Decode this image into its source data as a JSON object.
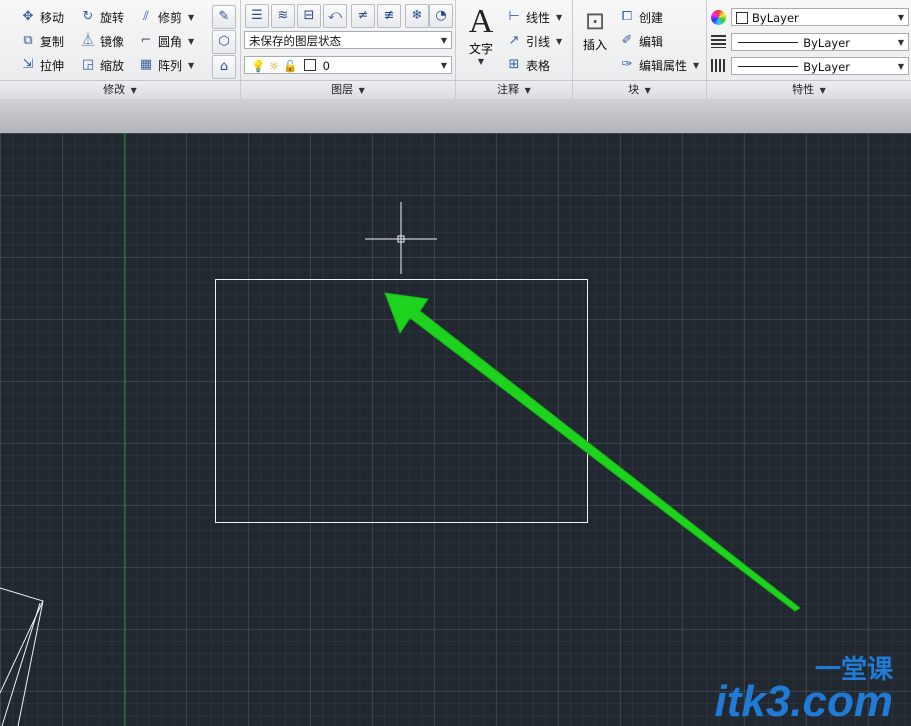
{
  "ribbon": {
    "modify": {
      "title": "修改",
      "move": "移动",
      "rotate": "旋转",
      "trim": "修剪",
      "copy": "复制",
      "mirror": "镜像",
      "fillet": "圆角",
      "stretch": "拉伸",
      "scale": "缩放",
      "array": "阵列"
    },
    "layers": {
      "title": "图层",
      "layer_state": "未保存的图层状态",
      "current_layer": "0"
    },
    "annotation": {
      "title": "注释",
      "text": "文字",
      "linear": "线性",
      "leader": "引线",
      "table": "表格"
    },
    "block": {
      "title": "块",
      "insert": "插入",
      "create": "创建",
      "edit": "编辑",
      "edit_attributes": "编辑属性"
    },
    "properties": {
      "title": "特性",
      "color": "ByLayer",
      "linetype": "ByLayer",
      "lineweight": "ByLayer"
    }
  },
  "watermark": {
    "brand": "itk3",
    "domain": ".com",
    "cn": "一堂课"
  },
  "colors": {
    "arrow": "#1ed31e",
    "canvas": "#212830",
    "green_axis": "#1f8f2a"
  }
}
